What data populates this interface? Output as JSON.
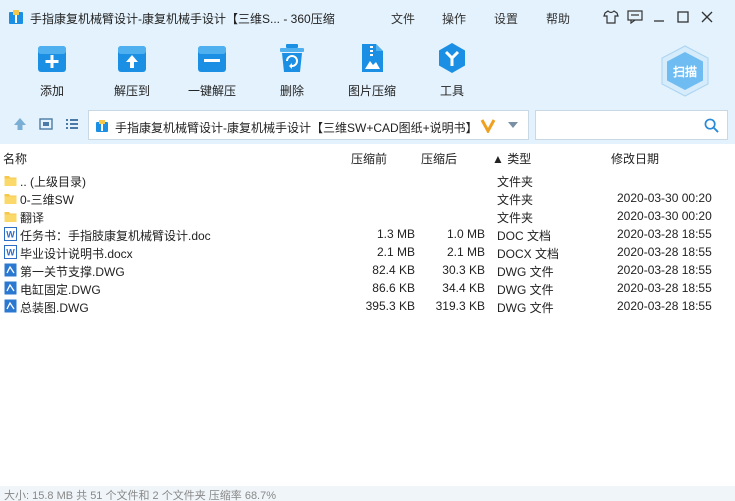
{
  "window": {
    "title": "手指康复机械臂设计-康复机械手设计【三维S... - 360压缩",
    "menu": [
      "文件",
      "操作",
      "设置",
      "帮助"
    ]
  },
  "toolbar": {
    "items": [
      {
        "label": "添加",
        "icon": "add-icon"
      },
      {
        "label": "解压到",
        "icon": "extract-to-icon"
      },
      {
        "label": "一键解压",
        "icon": "one-click-extract-icon"
      },
      {
        "label": "删除",
        "icon": "delete-icon"
      },
      {
        "label": "图片压缩",
        "icon": "image-compress-icon"
      },
      {
        "label": "工具",
        "icon": "tools-icon"
      }
    ],
    "scan_label": "扫描"
  },
  "nav": {
    "path": "手指康复机械臂设计-康复机械手设计【三维SW+CAD图纸+说明书】"
  },
  "columns": {
    "name": "名称",
    "original": "压缩前",
    "compressed": "压缩后",
    "type": "类型",
    "modified": "修改日期"
  },
  "files": [
    {
      "name": ".. (上级目录)",
      "original": "",
      "compressed": "",
      "type": "文件夹",
      "date": "",
      "icon": "folder"
    },
    {
      "name": "0-三维SW",
      "original": "",
      "compressed": "",
      "type": "文件夹",
      "date": "2020-03-30 00:20",
      "icon": "folder"
    },
    {
      "name": "翻译",
      "original": "",
      "compressed": "",
      "type": "文件夹",
      "date": "2020-03-30 00:20",
      "icon": "folder"
    },
    {
      "name": "任务书：手指肢康复机械臂设计.doc",
      "original": "1.3 MB",
      "compressed": "1.0 MB",
      "type": "DOC 文档",
      "date": "2020-03-28 18:55",
      "icon": "word"
    },
    {
      "name": "毕业设计说明书.docx",
      "original": "2.1 MB",
      "compressed": "2.1 MB",
      "type": "DOCX 文档",
      "date": "2020-03-28 18:55",
      "icon": "word"
    },
    {
      "name": "第一关节支撑.DWG",
      "original": "82.4 KB",
      "compressed": "30.3 KB",
      "type": "DWG 文件",
      "date": "2020-03-28 18:55",
      "icon": "dwg"
    },
    {
      "name": "电缸固定.DWG",
      "original": "86.6 KB",
      "compressed": "34.4 KB",
      "type": "DWG 文件",
      "date": "2020-03-28 18:55",
      "icon": "dwg"
    },
    {
      "name": "总装图.DWG",
      "original": "395.3 KB",
      "compressed": "319.3 KB",
      "type": "DWG 文件",
      "date": "2020-03-28 18:55",
      "icon": "dwg"
    }
  ],
  "status": "大小: 15.8 MB 共 51 个文件和 2 个文件夹 压缩率 68.7%",
  "colors": {
    "accent": "#1a8fe3",
    "chrome": "#e3f2fc",
    "folder": "#f5c84c"
  }
}
